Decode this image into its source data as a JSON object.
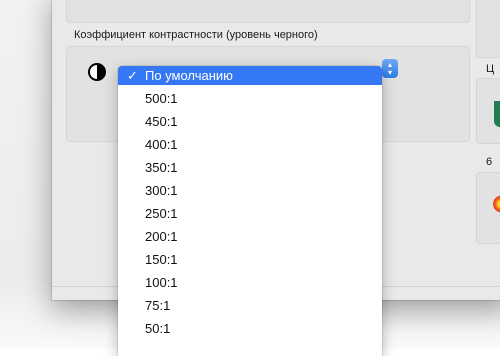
{
  "section": {
    "title": "Коэффициент контрастности (уровень черного)"
  },
  "contrast_select": {
    "selected": "По умолчанию",
    "check_glyph": "✓",
    "icon": "contrast-icon",
    "options": [
      "500:1",
      "450:1",
      "400:1",
      "350:1",
      "300:1",
      "250:1",
      "200:1",
      "150:1",
      "100:1",
      "75:1",
      "50:1"
    ]
  },
  "right_panel": {
    "label_top": "Ц",
    "label_bottom": "6"
  },
  "colors": {
    "selection": "#3478f6",
    "window_bg": "#e9e9e9",
    "group_bg": "#e2e2e2"
  }
}
